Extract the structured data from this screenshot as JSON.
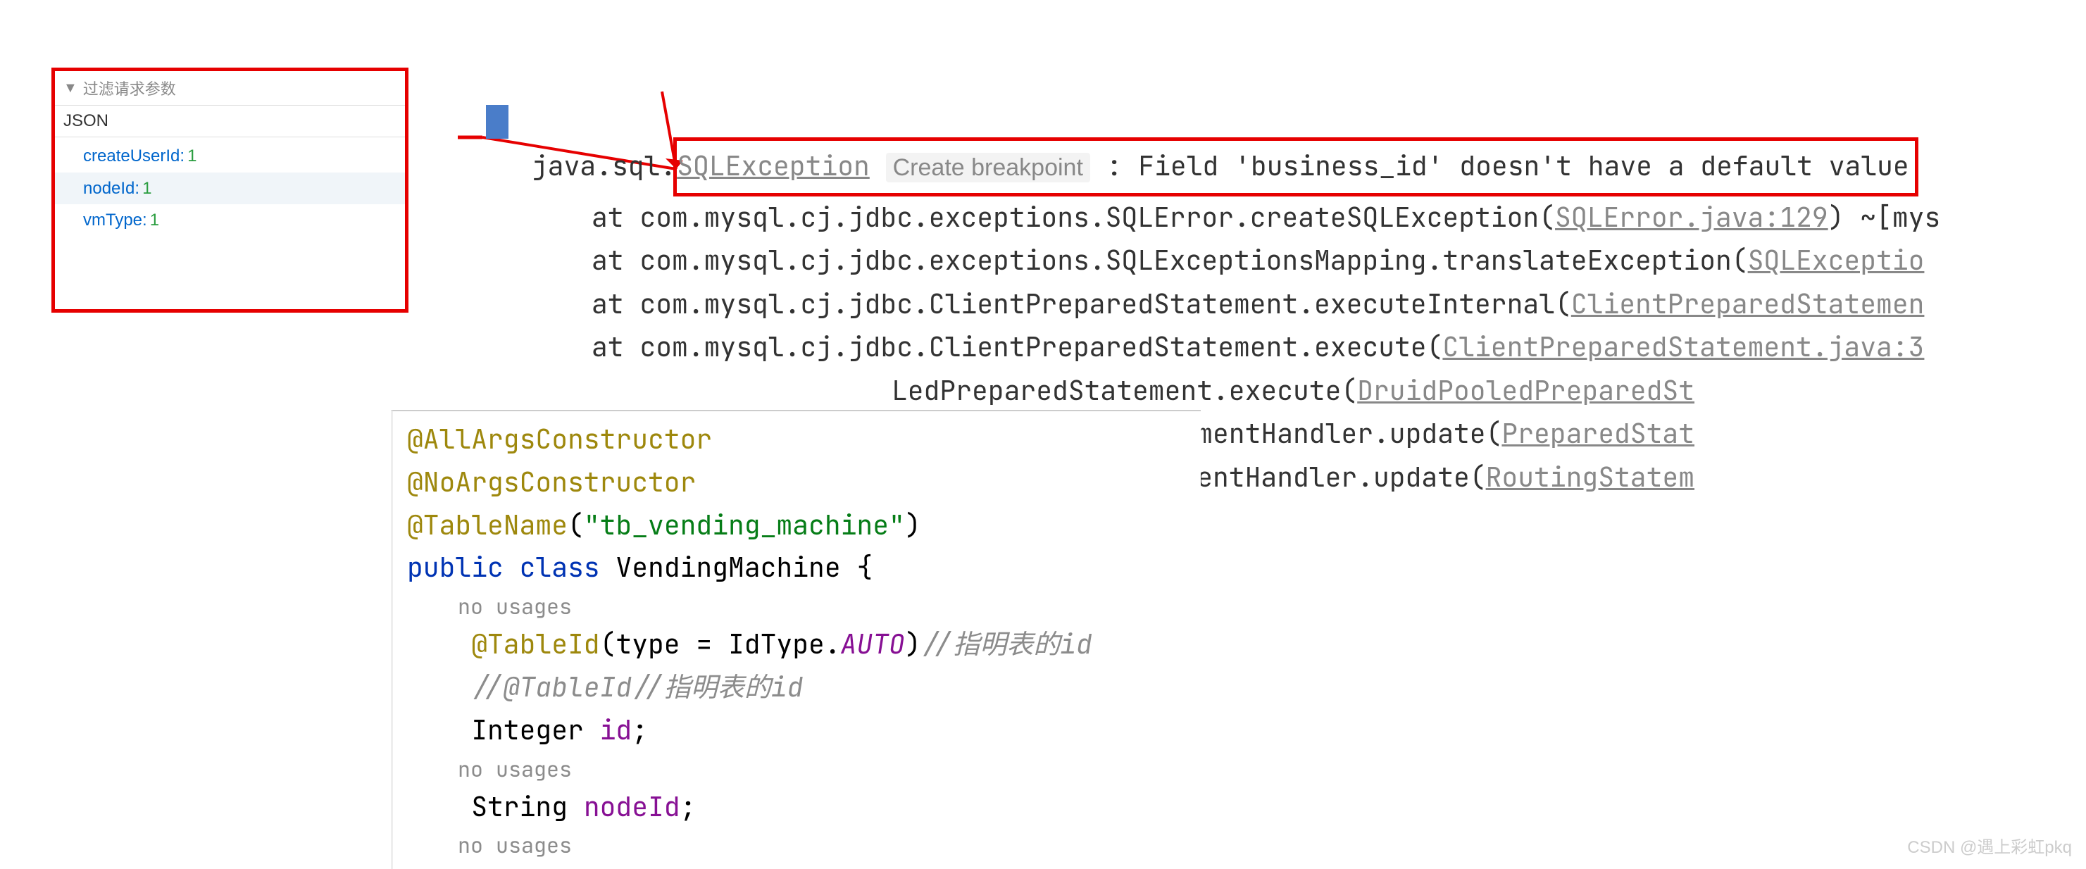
{
  "json_panel": {
    "filter_placeholder": "过滤请求参数",
    "header": "JSON",
    "items": [
      {
        "key": "createUserId:",
        "value": " 1"
      },
      {
        "key": "nodeId:",
        "value": " 1"
      },
      {
        "key": "vmType:",
        "value": " 1"
      }
    ]
  },
  "console": {
    "exception_prefix": "java.sql.",
    "exception_class": "SQLException",
    "create_breakpoint": "Create breakpoint",
    "exception_message": " : Field 'business_id' doesn't have a default value",
    "stack": [
      {
        "prefix": "at com.mysql.cj.jdbc.exceptions.SQLError.createSQLException(",
        "link": "SQLError.java:129",
        "suffix": ") ~[mys"
      },
      {
        "prefix": "at com.mysql.cj.jdbc.exceptions.SQLExceptionsMapping.translateException(",
        "link": "SQLExceptio",
        "suffix": ""
      },
      {
        "prefix": "at com.mysql.cj.jdbc.ClientPreparedStatement.executeInternal(",
        "link": "ClientPreparedStatemen",
        "suffix": ""
      },
      {
        "prefix": "at com.mysql.cj.jdbc.ClientPreparedStatement.execute(",
        "link": "ClientPreparedStatement.java:3",
        "suffix": ""
      }
    ],
    "stack_indented": [
      {
        "prefix": "LedPreparedStatement.execute(",
        "link": "DruidPooledPreparedSt",
        "suffix": ""
      },
      {
        "prefix": "ement.PreparedStatementHandler.update(",
        "link": "PreparedStat",
        "suffix": ""
      },
      {
        "prefix": "ement.RoutingStatementHandler.update(",
        "link": "RoutingStatem",
        "suffix": ""
      }
    ]
  },
  "code": {
    "lines": {
      "l1_anno": "@AllArgsConstructor",
      "l2_anno": "@NoArgsConstructor",
      "l3_anno": "@TableName",
      "l3_paren_open": "(",
      "l3_string": "\"tb_vending_machine\"",
      "l3_paren_close": ")",
      "l4_public": "public ",
      "l4_class": "class ",
      "l4_name": "VendingMachine ",
      "l4_brace": "{",
      "l5_hint": "    no usages",
      "l6_indent": "    ",
      "l6_anno": "@TableId",
      "l6_paren": "(type = IdType.",
      "l6_auto": "AUTO",
      "l6_close": ")",
      "l6_comment": "//指明表的id",
      "l7_indent": "    ",
      "l7_comment": "//@TableId//指明表的id",
      "l8_indent": "    Integer ",
      "l8_field": "id",
      "l8_semi": ";",
      "l9_hint": "    no usages",
      "l10_indent": "    String ",
      "l10_field": "nodeId",
      "l10_semi": ";",
      "l11_hint": "    no usages"
    }
  },
  "watermark": "CSDN @遇上彩虹pkq"
}
